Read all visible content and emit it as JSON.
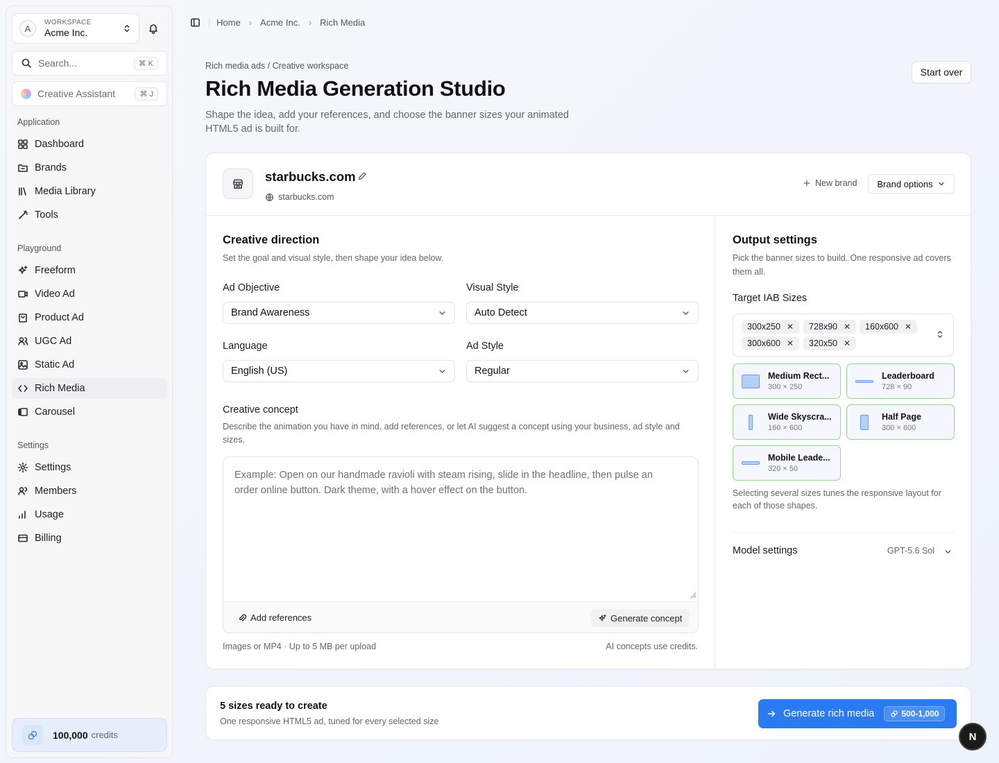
{
  "workspace": {
    "label": "WORKSPACE",
    "avatar": "A",
    "name": "Acme Inc."
  },
  "search": {
    "placeholder": "Search...",
    "shortcut": "⌘ K"
  },
  "assistant": {
    "label": "Creative Assistant",
    "shortcut": "⌘ J"
  },
  "sidebar": {
    "groups": [
      {
        "label": "Application",
        "items": [
          {
            "label": "Dashboard",
            "icon": "dashboard-icon"
          },
          {
            "label": "Brands",
            "icon": "brands-icon"
          },
          {
            "label": "Media Library",
            "icon": "library-icon"
          },
          {
            "label": "Tools",
            "icon": "wand-icon"
          }
        ]
      },
      {
        "label": "Playground",
        "items": [
          {
            "label": "Freeform",
            "icon": "sparkles-icon"
          },
          {
            "label": "Video Ad",
            "icon": "video-icon"
          },
          {
            "label": "Product Ad",
            "icon": "bag-icon"
          },
          {
            "label": "UGC Ad",
            "icon": "users-icon"
          },
          {
            "label": "Static Ad",
            "icon": "image-icon"
          },
          {
            "label": "Rich Media",
            "icon": "code-icon",
            "active": true
          },
          {
            "label": "Carousel",
            "icon": "carousel-icon"
          }
        ]
      },
      {
        "label": "Settings",
        "items": [
          {
            "label": "Settings",
            "icon": "gear-icon"
          },
          {
            "label": "Members",
            "icon": "members-icon"
          },
          {
            "label": "Usage",
            "icon": "bars-icon"
          },
          {
            "label": "Billing",
            "icon": "card-icon"
          }
        ]
      }
    ],
    "credits": {
      "amount": "100,000",
      "unit": "credits"
    }
  },
  "breadcrumb": [
    "Home",
    "Acme Inc.",
    "Rich Media"
  ],
  "header": {
    "eyebrow": "Rich media ads / Creative workspace",
    "title": "Rich Media Generation Studio",
    "subtitle": "Shape the idea, add your references, and choose the banner sizes your animated HTML5 ad is built for.",
    "start_over": "Start over"
  },
  "brand": {
    "name": "starbucks.com",
    "url": "starbucks.com",
    "new_brand": "New brand",
    "options": "Brand options"
  },
  "creative": {
    "title": "Creative direction",
    "desc": "Set the goal and visual style, then shape your idea below.",
    "objective": {
      "label": "Ad Objective",
      "value": "Brand Awareness"
    },
    "visual_style": {
      "label": "Visual Style",
      "value": "Auto Detect"
    },
    "language": {
      "label": "Language",
      "value": "English (US)"
    },
    "ad_style": {
      "label": "Ad Style",
      "value": "Regular"
    },
    "concept": {
      "label": "Creative concept",
      "desc": "Describe the animation you have in mind, add references, or let AI suggest a concept using your business, ad style and sizes.",
      "placeholder": "Example: Open on our handmade ravioli with steam rising, slide in the headline, then pulse an order online button. Dark theme, with a hover effect on the button.",
      "add_references": "Add references",
      "generate": "Generate concept"
    },
    "upload_note": "Images or MP4 · Up to 5 MB per upload",
    "credits_note": "AI concepts use credits."
  },
  "output": {
    "title": "Output settings",
    "desc": "Pick the banner sizes to build. One responsive ad covers them all.",
    "target_label": "Target IAB Sizes",
    "chips": [
      "300x250",
      "728x90",
      "160x600",
      "300x600",
      "320x50"
    ],
    "tiles": [
      {
        "name": "Medium Rect...",
        "dims": "300 × 250"
      },
      {
        "name": "Leaderboard",
        "dims": "728 × 90"
      },
      {
        "name": "Wide Skyscra...",
        "dims": "160 × 600"
      },
      {
        "name": "Half Page",
        "dims": "300 × 600"
      },
      {
        "name": "Mobile Leade...",
        "dims": "320 × 50"
      }
    ],
    "note": "Selecting several sizes tunes the responsive layout for each of those shapes.",
    "model_label": "Model settings",
    "model_value": "GPT-5.6 Sol"
  },
  "footer": {
    "title": "5 sizes ready to create",
    "sub": "One responsive HTML5 ad, tuned for every selected size",
    "button": "Generate rich media",
    "cost": "500-1,000"
  },
  "corner_badge": "N",
  "colors": {
    "accent": "#2b7bf0",
    "tile_border": "#9ad48e",
    "tile_bg": "#f4f8fe",
    "credits_bg": "#e6eefc"
  }
}
